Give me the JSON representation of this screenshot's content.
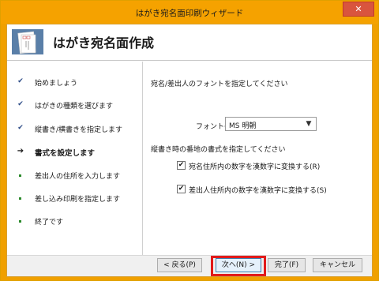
{
  "window": {
    "title": "はがき宛名面印刷ウィザード",
    "close_label": "✕"
  },
  "header": {
    "title": "はがき宛名面作成",
    "icon": "postcard-icon"
  },
  "steps": [
    {
      "label": "始めましょう",
      "mark": "✔",
      "state": "done"
    },
    {
      "label": "はがきの種類を選びます",
      "mark": "✔",
      "state": "done"
    },
    {
      "label": "縦書き/横書きを指定します",
      "mark": "✔",
      "state": "done"
    },
    {
      "label": "書式を設定します",
      "mark": "➔",
      "state": "current"
    },
    {
      "label": "差出人の住所を入力します",
      "mark": "",
      "state": "pending"
    },
    {
      "label": "差し込み印刷を指定します",
      "mark": "",
      "state": "pending"
    },
    {
      "label": "終了です",
      "mark": "",
      "state": "pending"
    }
  ],
  "font_section": {
    "heading": "宛名/差出人のフォントを指定してください",
    "font_label": "フォント(O):",
    "font_value": "MS 明朝"
  },
  "number_section": {
    "heading": "縦書き時の番地の書式を指定してください",
    "checkbox1_label": "宛名住所内の数字を漢数字に変換する(R)",
    "checkbox1_checked": true,
    "checkbox2_label": "差出人住所内の数字を漢数字に変換する(S)",
    "checkbox2_checked": true
  },
  "buttons": {
    "back": "< 戻る(P)",
    "next": "次へ(N) >",
    "finish": "完了(F)",
    "cancel": "キャンセル"
  },
  "colors": {
    "title_bar": "#f5a200",
    "highlight": "#e11a1a",
    "check_mark": "#2b4a86",
    "pending_dot": "#2b8a2b"
  }
}
